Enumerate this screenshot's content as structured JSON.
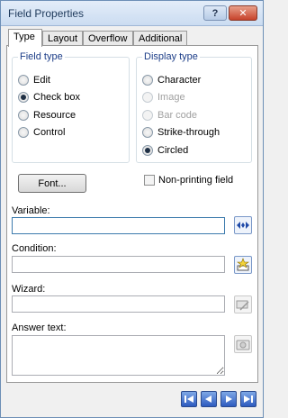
{
  "window": {
    "title": "Field Properties",
    "help_label": "?",
    "close_label": "✕"
  },
  "tabs": [
    {
      "label": "Type",
      "active": true
    },
    {
      "label": "Layout"
    },
    {
      "label": "Overflow"
    },
    {
      "label": "Additional"
    }
  ],
  "field_type": {
    "title": "Field type",
    "options": [
      {
        "label": "Edit",
        "selected": false
      },
      {
        "label": "Check box",
        "selected": true
      },
      {
        "label": "Resource",
        "selected": false
      },
      {
        "label": "Control",
        "selected": false
      }
    ]
  },
  "display_type": {
    "title": "Display type",
    "options": [
      {
        "label": "Character",
        "selected": false,
        "enabled": true
      },
      {
        "label": "Image",
        "selected": false,
        "enabled": false
      },
      {
        "label": "Bar code",
        "selected": false,
        "enabled": false
      },
      {
        "label": "Strike-through",
        "selected": false,
        "enabled": true
      },
      {
        "label": "Circled",
        "selected": true,
        "enabled": true
      }
    ]
  },
  "font_button": "Font...",
  "non_printing": {
    "label": "Non-printing field",
    "checked": false
  },
  "variable": {
    "label": "Variable:",
    "value": ""
  },
  "condition": {
    "label": "Condition:",
    "value": ""
  },
  "wizard": {
    "label": "Wizard:",
    "value": ""
  },
  "answer_text": {
    "label": "Answer text:",
    "value": ""
  },
  "icons": {
    "variable_button": "double-arrow-icon",
    "condition_button": "condition-wand-icon",
    "wizard_button": "wizard-icon",
    "answer_button": "camera-icon"
  },
  "colors": {
    "group_title": "#1d3e88",
    "nav_button": "#2d5bbf",
    "title_text": "#1e395b"
  }
}
